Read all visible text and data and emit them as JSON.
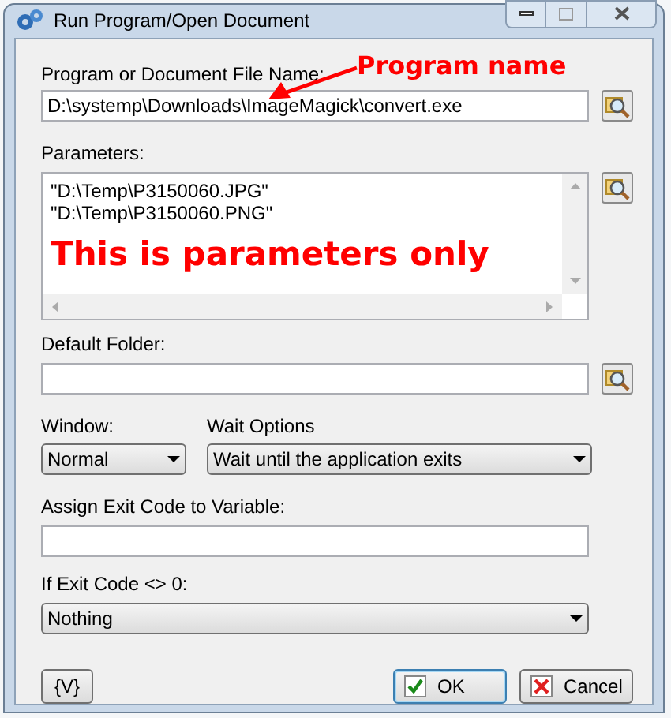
{
  "window": {
    "title": "Run Program/Open Document"
  },
  "program": {
    "label": "Program or Document File Name:",
    "value": "D:\\systemp\\Downloads\\ImageMagick\\convert.exe"
  },
  "parameters": {
    "label": "Parameters:",
    "lines": [
      "\"D:\\Temp\\P3150060.JPG\"",
      "\"D:\\Temp\\P3150060.PNG\""
    ]
  },
  "default_folder": {
    "label": "Default Folder:"
  },
  "window_mode": {
    "label": "Window:",
    "value": "Normal"
  },
  "wait_options": {
    "label": "Wait Options",
    "value": "Wait until the application exits"
  },
  "exit_code_variable": {
    "label": "Assign Exit Code to Variable:"
  },
  "if_exit_code": {
    "label": "If Exit Code <> 0:",
    "value": "Nothing"
  },
  "annotations": [
    {
      "kind": "arrow",
      "text": "Program name"
    },
    {
      "kind": "overlay",
      "text": "This is parameters only"
    }
  ],
  "buttons": [
    {
      "kind": "variable",
      "label": "{V}"
    },
    {
      "kind": "ok",
      "label": "OK",
      "selected": true
    },
    {
      "kind": "cancel",
      "label": "Cancel",
      "selected": false
    }
  ]
}
